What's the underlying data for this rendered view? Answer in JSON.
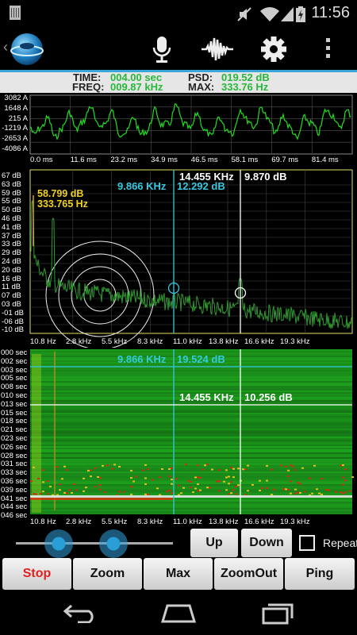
{
  "status_bar": {
    "time": "11:56"
  },
  "readout": {
    "time_label": "TIME:",
    "time_value": "004.00 sec",
    "freq_label": "FREQ:",
    "freq_value": "009.87 kHz",
    "psd_label": "PSD:",
    "psd_value": "019.52 dB",
    "max_label": "MAX:",
    "max_value": "333.76 Hz"
  },
  "waveform": {
    "y_labels": [
      "3082 A",
      "1648 A",
      "215 A",
      "-1219 A",
      "-2653 A",
      "-4086 A"
    ],
    "x_labels": [
      "0.0 ms",
      "11.6 ms",
      "23.2 ms",
      "34.9 ms",
      "46.5 ms",
      "58.1 ms",
      "69.7 ms",
      "81.4 ms"
    ]
  },
  "spectrum": {
    "y_labels": [
      "67 dB",
      "63 dB",
      "59 dB",
      "55 dB",
      "50 dB",
      "46 dB",
      "41 dB",
      "37 dB",
      "33 dB",
      "29 dB",
      "24 dB",
      "20 dB",
      "16 dB",
      "11 dB",
      "07 dB",
      "03 dB",
      "-01 dB",
      "-06 dB",
      "-10 dB"
    ],
    "x_labels": [
      "10.8 Hz",
      "2.8 kHz",
      "5.5 kHz",
      "8.3 kHz",
      "11.0 kHz",
      "13.8 kHz",
      "16.6 kHz",
      "19.3 kHz"
    ],
    "peak_db": "58.799 dB",
    "peak_hz": "333.765 Hz",
    "cursor_cyan_freq": "9.866 KHz",
    "cursor_cyan_db": "12.292 dB",
    "cursor_white_freq": "14.455 KHz",
    "cursor_white_db": "9.870 dB"
  },
  "spectrogram": {
    "y_labels": [
      "000 sec",
      "002 sec",
      "003 sec",
      "005 sec",
      "008 sec",
      "010 sec",
      "013 sec",
      "015 sec",
      "018 sec",
      "021 sec",
      "023 sec",
      "026 sec",
      "028 sec",
      "031 sec",
      "033 sec",
      "036 sec",
      "039 sec",
      "041 sec",
      "044 sec",
      "046 sec"
    ],
    "x_labels": [
      "10.8 Hz",
      "2.8 kHz",
      "5.5 kHz",
      "8.3 kHz",
      "11.0 kHz",
      "13.8 kHz",
      "16.6 kHz",
      "19.3 kHz"
    ],
    "cursor_cyan_freq": "9.866 KHz",
    "cursor_cyan_db": "19.524 dB",
    "cursor_white_freq": "14.455 KHz",
    "cursor_white_db": "10.256 dB"
  },
  "controls": {
    "up_label": "Up",
    "down_label": "Down",
    "repeat_label": "Repeat",
    "repeat_checked": false
  },
  "bottom_buttons": {
    "stop": "Stop",
    "zoom": "Zoom",
    "max": "Max",
    "zoomout": "ZoomOut",
    "ping": "Ping"
  },
  "colors": {
    "accent_blue": "#3aa6d8",
    "value_green": "#26b83a",
    "stop_red": "#e02020",
    "cursor_cyan": "#35c9e0",
    "peak_yellow": "#f0d020"
  }
}
